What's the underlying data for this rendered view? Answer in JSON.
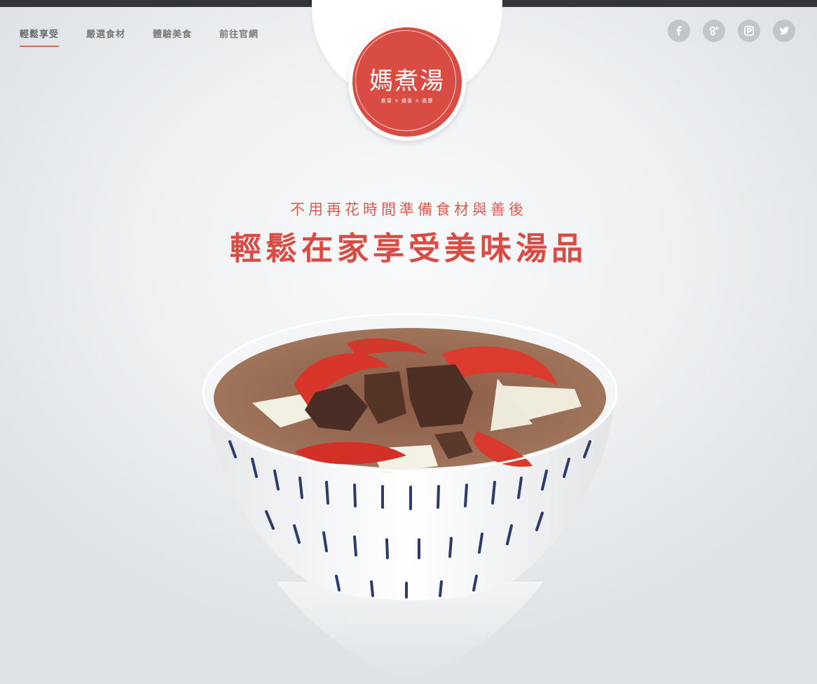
{
  "nav": {
    "items": [
      {
        "label": "輕鬆享受",
        "active": true
      },
      {
        "label": "嚴選食材",
        "active": false
      },
      {
        "label": "體驗美食",
        "active": false
      },
      {
        "label": "前往官網",
        "active": false
      }
    ]
  },
  "logo": {
    "title": "媽煮湯",
    "tagline": "煮湯 × 煮香 × 煮康"
  },
  "social": [
    {
      "icon": "facebook-icon"
    },
    {
      "icon": "google-plus-icon"
    },
    {
      "icon": "plurk-icon"
    },
    {
      "icon": "twitter-icon"
    }
  ],
  "hero": {
    "subheading": "不用再花時間準備食材與善後",
    "headline": "輕鬆在家享受美味湯品"
  },
  "colors": {
    "accent": "#d94c43",
    "top_bar": "#333538",
    "icon_gray": "#c3c6c9"
  }
}
